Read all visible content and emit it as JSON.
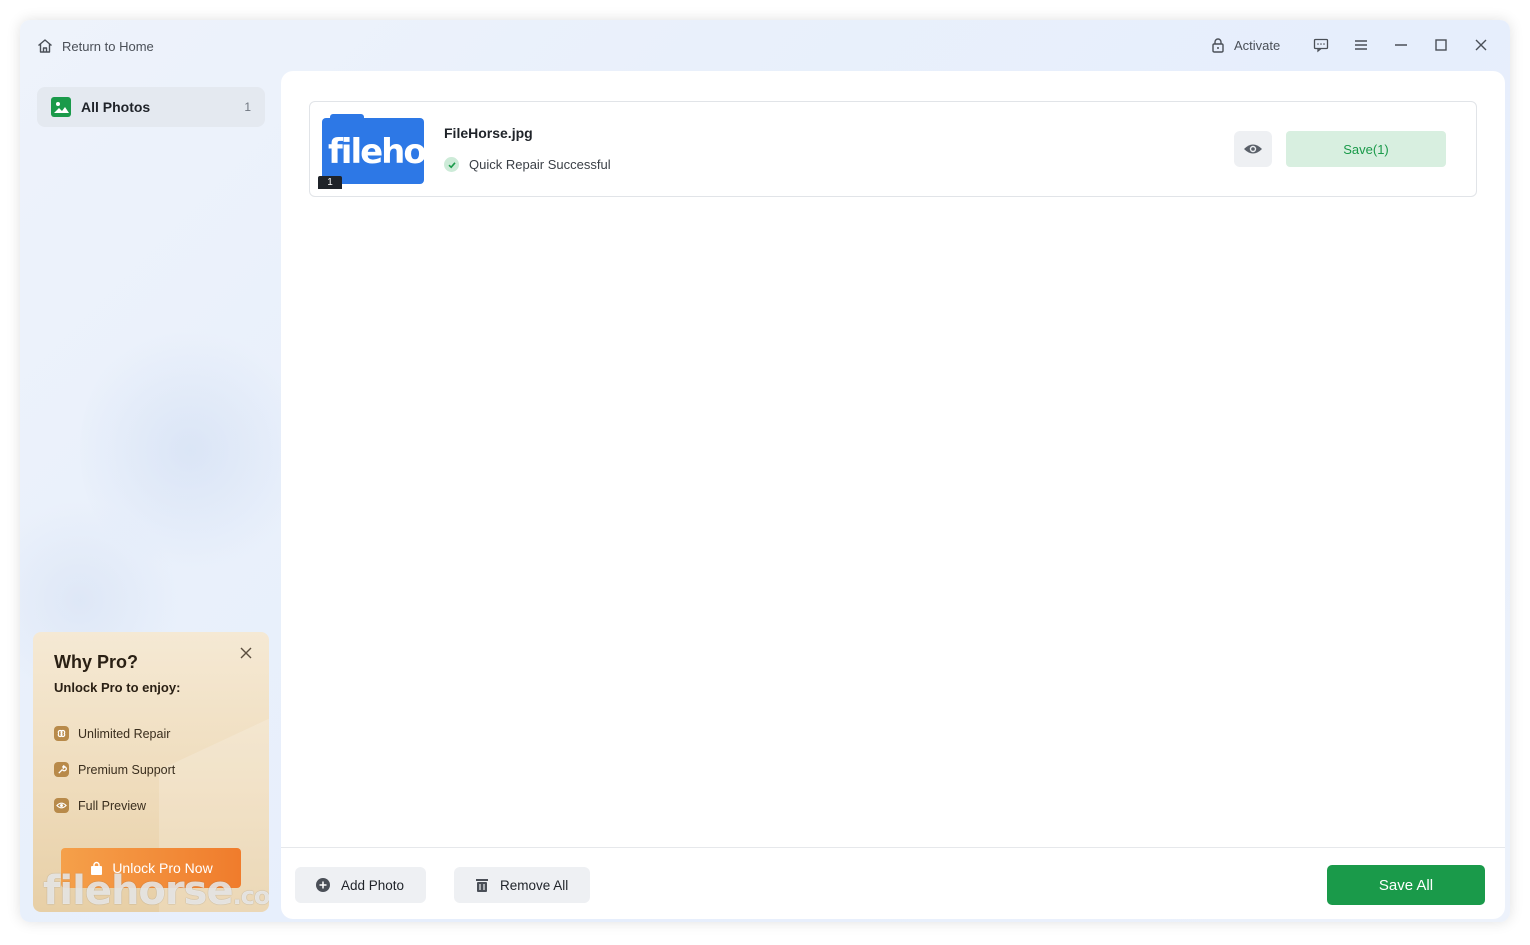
{
  "titlebar": {
    "return_home": "Return to Home",
    "activate": "Activate"
  },
  "sidebar": {
    "items": [
      {
        "label": "All Photos",
        "count": "1"
      }
    ]
  },
  "pro_card": {
    "title": "Why Pro?",
    "subtitle": "Unlock Pro to enjoy:",
    "features": [
      {
        "label": "Unlimited Repair",
        "icon": "infinity-icon"
      },
      {
        "label": "Premium Support",
        "icon": "wrench-icon"
      },
      {
        "label": "Full Preview",
        "icon": "eye-icon"
      }
    ],
    "button": "Unlock Pro Now",
    "watermark": "filehorse",
    "watermark_suffix": ".com"
  },
  "files": [
    {
      "name": "FileHorse.jpg",
      "status": "Quick Repair Successful",
      "thumb_text": "filehorse",
      "badge": "1",
      "save_label": "Save(1)"
    }
  ],
  "bottom": {
    "add_photo": "Add Photo",
    "remove_all": "Remove All",
    "save_all": "Save All"
  },
  "colors": {
    "accent_green": "#1a9a4a",
    "unlock_orange": "#f07c2c",
    "thumb_blue": "#2d78e6"
  }
}
